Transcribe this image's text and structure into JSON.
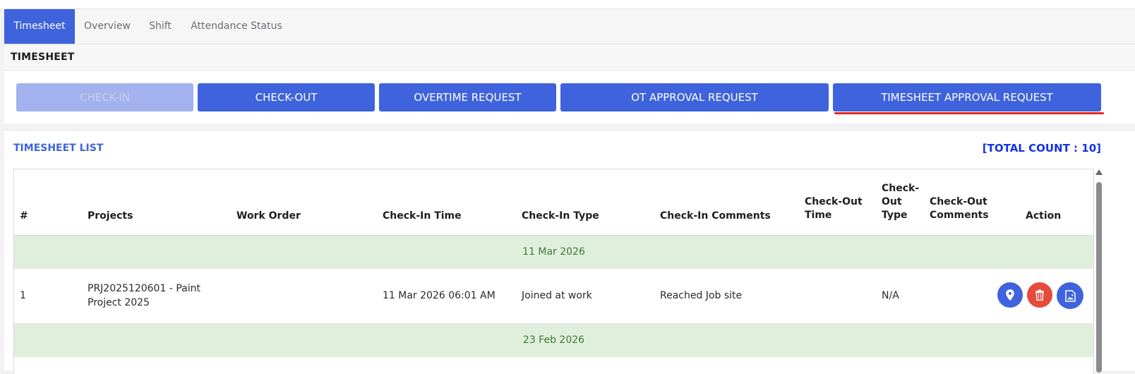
{
  "tabs": [
    {
      "label": "Timesheet",
      "active": true
    },
    {
      "label": "Overview",
      "active": false
    },
    {
      "label": "Shift",
      "active": false
    },
    {
      "label": "Attendance Status",
      "active": false
    }
  ],
  "section_title": "TIMESHEET",
  "buttons": {
    "check_in": "CHECK-IN",
    "check_out": "CHECK-OUT",
    "overtime_request": "OVERTIME REQUEST",
    "ot_approval_request": "OT APPROVAL REQUEST",
    "timesheet_approval_request": "TIMESHEET APPROVAL REQUEST"
  },
  "list": {
    "title": "TIMESHEET LIST",
    "total_count": "[TOTAL COUNT : 10]"
  },
  "table": {
    "headers": {
      "num": "#",
      "projects": "Projects",
      "work_order": "Work Order",
      "check_in_time": "Check-In Time",
      "check_in_type": "Check-In Type",
      "check_in_comments": "Check-In Comments",
      "check_out_time_1": "Check-Out",
      "check_out_time_2": "Time",
      "check_out_type_1": "Check-",
      "check_out_type_2": "Out",
      "check_out_type_3": "Type",
      "check_out_comments_1": "Check-Out",
      "check_out_comments_2": "Comments",
      "action": "Action"
    },
    "groups": [
      {
        "date": "11 Mar 2026",
        "rows": [
          {
            "num": "1",
            "project_line1": "PRJ2025120601 - Paint",
            "project_line2": "Project 2025",
            "work_order": "",
            "check_in_time": "11 Mar 2026 06:01 AM",
            "check_in_type": "Joined at work",
            "check_in_comments": "Reached Job site",
            "check_out_time": "",
            "check_out_type": "N/A",
            "check_out_comments": ""
          }
        ]
      },
      {
        "date": "23 Feb 2026",
        "rows": []
      }
    ]
  },
  "icons": {
    "location": "location-pin-icon",
    "delete": "trash-icon",
    "image": "image-file-icon"
  },
  "colors": {
    "primary": "#3f63dc",
    "disabled": "#a1b2ee",
    "delete": "#e64a3c",
    "date_row": "#e0efdc",
    "date_text": "#3c7a36",
    "total_count": "#1433e4",
    "underline": "#e02626"
  }
}
